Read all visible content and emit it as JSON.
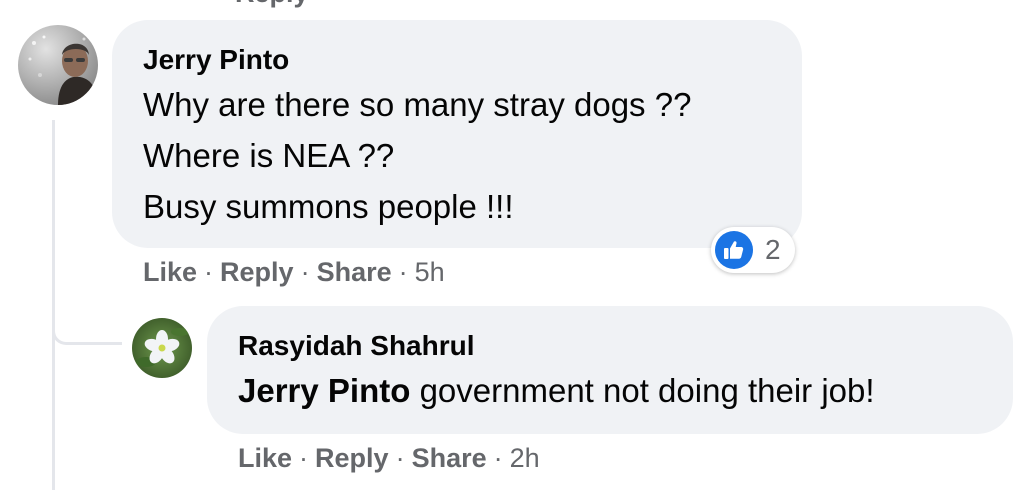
{
  "previous_action_partial": "Reply",
  "comment": {
    "author": "Jerry Pinto",
    "lines": [
      "Why are there so many stray dogs ??",
      "Where is NEA ??",
      "Busy summons people !!!"
    ],
    "actions": {
      "like": "Like",
      "reply": "Reply",
      "share": "Share",
      "time": "5h"
    },
    "reactions": {
      "icon": "thumbs-up-icon",
      "count": "2",
      "color": "#1b74e4"
    }
  },
  "reply": {
    "author": "Rasyidah Shahrul",
    "mention": "Jerry Pinto",
    "text": " government not doing their job!",
    "actions": {
      "like": "Like",
      "reply": "Reply",
      "share": "Share",
      "time": "2h"
    }
  },
  "separator": "·"
}
